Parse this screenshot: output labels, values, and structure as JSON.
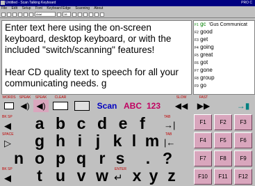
{
  "window": {
    "title": "Untitled - Scan Talking Keyboard",
    "right_title": "PRO C"
  },
  "menu": [
    "File",
    "Edit",
    "Setup",
    "Font",
    "Keyboard Edge",
    "Scanning",
    "About"
  ],
  "toolbar": {
    "font_box": "Arial",
    "size_box": "18"
  },
  "text": {
    "para1": "Enter text here using the on-screen keyboard,  desktop keyboard,  or with the included \"switch/scanning\" features!",
    "para2": "Hear CD quality text to speech for all your communicating needs.  g"
  },
  "predictions": [
    {
      "key": "F1",
      "word": "gc",
      "extra": "'Gus Communicat"
    },
    {
      "key": "F2",
      "word": "good"
    },
    {
      "key": "F3",
      "word": "get"
    },
    {
      "key": "F4",
      "word": "going"
    },
    {
      "key": "F5",
      "word": "great"
    },
    {
      "key": "F6",
      "word": "got"
    },
    {
      "key": "F7",
      "word": "gone"
    },
    {
      "key": "F8",
      "word": "group"
    },
    {
      "key": "F9",
      "word": "go"
    }
  ],
  "controls": {
    "words": "WORDS",
    "speak": "SPEAK",
    "speak_letters": "SPEAK",
    "clear": "CLEAR",
    "scan": "Scan",
    "abc": "ABC",
    "nums": "123",
    "slow": "SLOW",
    "fast": "FAST"
  },
  "keys": {
    "row1": {
      "small_left": "BK SP",
      "letters": [
        "a",
        "b",
        "c",
        "d",
        "e",
        "f"
      ],
      "small_right": "TAB"
    },
    "row2": {
      "small_left": "SPACE",
      "letters": [
        "g",
        "h",
        "i",
        "j",
        "k",
        "l",
        "m"
      ],
      "small_right": "TAB"
    },
    "row3": {
      "letters": [
        "n",
        "o",
        "p",
        "q",
        "r",
        "s",
        ".",
        "?"
      ]
    },
    "row4": {
      "small_left": "BK SP",
      "letters": [
        "t",
        "u",
        "v",
        "w",
        "x",
        "y",
        "z"
      ],
      "small_mid": "ENTER"
    }
  },
  "fkeys": [
    "F1",
    "F2",
    "F3",
    "F4",
    "F5",
    "F6",
    "F7",
    "F8",
    "F9",
    "F10",
    "F11",
    "F12"
  ],
  "colors": {
    "fkey": "#d9a6bd",
    "titlebar": "#000080",
    "labels": "#c00000"
  }
}
